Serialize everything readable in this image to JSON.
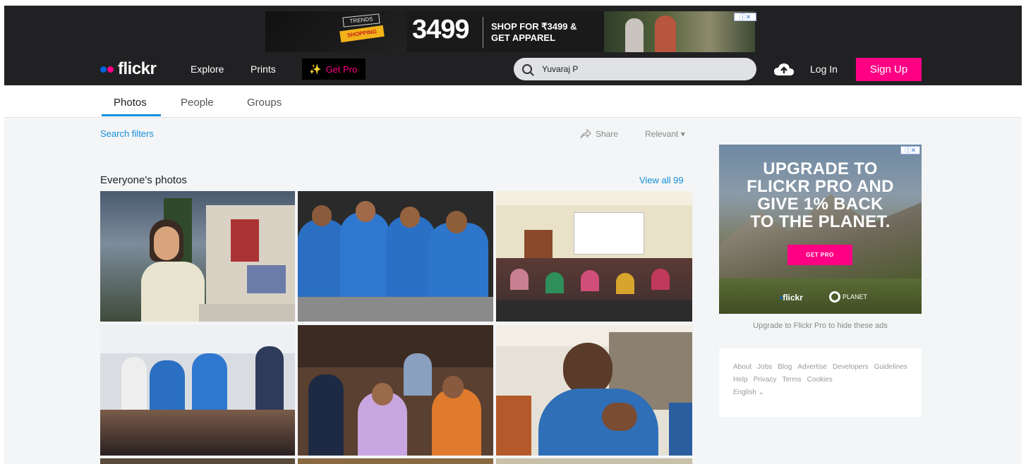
{
  "top_ad": {
    "trends_label": "TRENDS",
    "shopping_label": "SHOPPING",
    "big_number": "3499",
    "headline_line1": "SHOP FOR ₹3499 &",
    "headline_line2": "GET APPAREL",
    "adchoices_label": "ⓘ✕"
  },
  "header": {
    "logo_text": "flickr",
    "nav": {
      "explore": "Explore",
      "prints": "Prints",
      "get_pro": "Get Pro"
    },
    "search": {
      "value": "Yuvaraj P",
      "placeholder": ""
    },
    "login": "Log In",
    "signup": "Sign Up"
  },
  "tabs": [
    "Photos",
    "People",
    "Groups"
  ],
  "toolbar": {
    "search_filters": "Search filters",
    "share": "Share",
    "sort": "Relevant ▾"
  },
  "results": {
    "section_title": "Everyone's photos",
    "view_all": "View all 99"
  },
  "promo": {
    "headline_line1": "UPGRADE TO",
    "headline_line2": "FLICKR PRO AND",
    "headline_line3": "GIVE 1% BACK",
    "headline_line4": "TO THE PLANET.",
    "cta": "GET PRO",
    "brand": "flickr",
    "partner": "PLANET",
    "adchoices_label": "ⓘ✕",
    "note": "Upgrade to Flickr Pro to hide these ads"
  },
  "footer": {
    "links": [
      "About",
      "Jobs",
      "Blog",
      "Advertise",
      "Developers",
      "Guidelines",
      "Help",
      "Privacy",
      "Terms",
      "Cookies"
    ],
    "language": "English ⌄"
  },
  "colors": {
    "flickr_blue": "#0063dc",
    "flickr_pink": "#ff0084",
    "link_blue": "#128fdc",
    "nav_dark": "#212124"
  }
}
